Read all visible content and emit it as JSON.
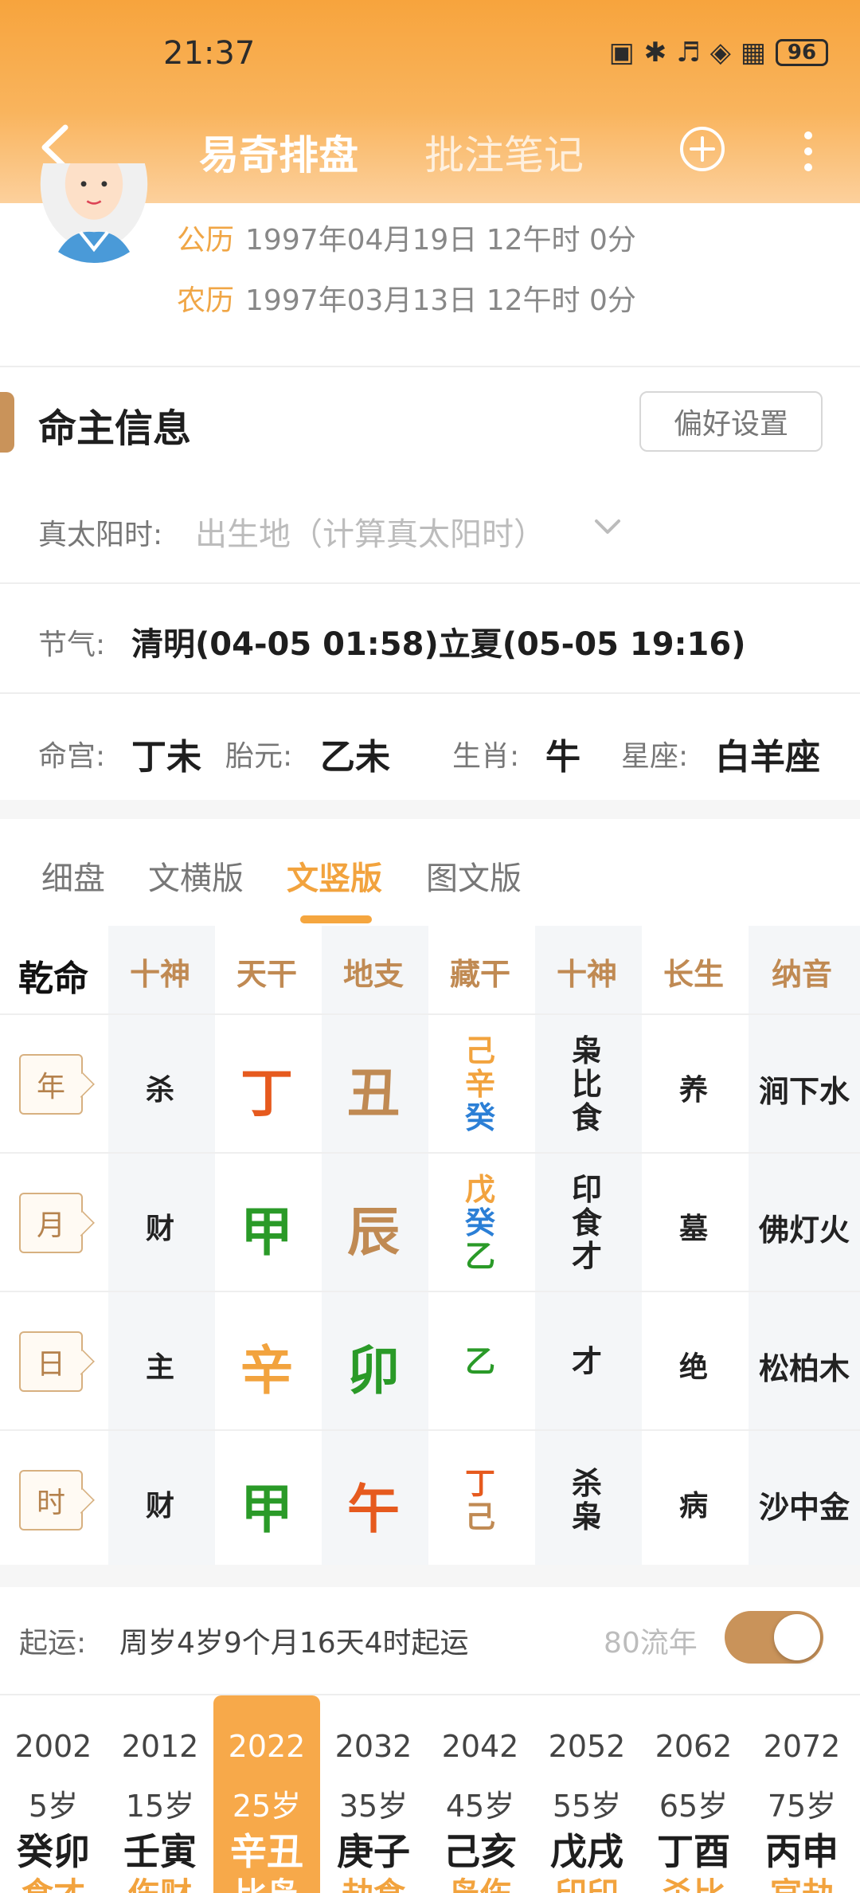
{
  "status": {
    "time": "21:37",
    "battery": "96"
  },
  "header": {
    "active_tab": "易奇排盘",
    "inactive_tab": "批注笔记"
  },
  "profile": {
    "solar_label": "公历",
    "solar_value": "1997年04月19日 12午时 0分",
    "lunar_label": "农历",
    "lunar_value": "1997年03月13日 12午时 0分"
  },
  "section": {
    "title": "命主信息",
    "pref_button": "偏好设置"
  },
  "solar_time": {
    "label": "真太阳时:",
    "placeholder": "出生地（计算真太阳时）"
  },
  "jieqi": {
    "label": "节气:",
    "value": "清明(04-05 01:58)立夏(05-05 19:16)"
  },
  "info": {
    "minggong_label": "命宫:",
    "minggong": "丁未",
    "taiyuan_label": "胎元:",
    "taiyuan": "乙未",
    "shengxiao_label": "生肖:",
    "shengxiao": "牛",
    "xingzuo_label": "星座:",
    "xingzuo": "白羊座"
  },
  "view_tabs": [
    "细盘",
    "文横版",
    "文竖版",
    "图文版"
  ],
  "grid": {
    "headers": [
      "乾命",
      "十神",
      "天干",
      "地支",
      "藏干",
      "十神",
      "长生",
      "纳音"
    ],
    "rows": [
      {
        "pillar": "年",
        "shishen": "杀",
        "tiangan": "丁",
        "dizhi": "丑",
        "canggan": [
          "己",
          "辛",
          "癸"
        ],
        "shishen2": [
          "枭",
          "比",
          "食"
        ],
        "changsheng": "养",
        "nayin": "涧下水"
      },
      {
        "pillar": "月",
        "shishen": "财",
        "tiangan": "甲",
        "dizhi": "辰",
        "canggan": [
          "戊",
          "癸",
          "乙"
        ],
        "shishen2": [
          "印",
          "食",
          "才"
        ],
        "changsheng": "墓",
        "nayin": "佛灯火"
      },
      {
        "pillar": "日",
        "shishen": "主",
        "tiangan": "辛",
        "dizhi": "卯",
        "canggan": [
          "乙"
        ],
        "shishen2": [
          "才"
        ],
        "changsheng": "绝",
        "nayin": "松柏木"
      },
      {
        "pillar": "时",
        "shishen": "财",
        "tiangan": "甲",
        "dizhi": "午",
        "canggan": [
          "丁",
          "己"
        ],
        "shishen2": [
          "杀",
          "枭"
        ],
        "changsheng": "病",
        "nayin": "沙中金"
      }
    ],
    "colors": {
      "tiangan": [
        "orange",
        "green",
        "gold",
        "green"
      ],
      "dizhi": [
        "brown",
        "brown",
        "green",
        "orange"
      ],
      "canggan": [
        [
          "gold",
          "gold",
          "blue"
        ],
        [
          "gold",
          "blue",
          "green"
        ],
        [
          "green"
        ],
        [
          "orange",
          "brown"
        ]
      ]
    }
  },
  "qiyun": {
    "label": "起运:",
    "value": "周岁4岁9个月16天4时起运",
    "liunian_label": "80流年",
    "toggle_on": true
  },
  "dayun": [
    {
      "year": "2002",
      "age": "5岁",
      "ganzhi": "癸卯",
      "peek": "食才"
    },
    {
      "year": "2012",
      "age": "15岁",
      "ganzhi": "壬寅",
      "peek": "伤财"
    },
    {
      "year": "2022",
      "age": "25岁",
      "ganzhi": "辛丑",
      "peek": "比枭",
      "active": true
    },
    {
      "year": "2032",
      "age": "35岁",
      "ganzhi": "庚子",
      "peek": "劫食"
    },
    {
      "year": "2042",
      "age": "45岁",
      "ganzhi": "己亥",
      "peek": "枭伤"
    },
    {
      "year": "2052",
      "age": "55岁",
      "ganzhi": "戊戌",
      "peek": "印印"
    },
    {
      "year": "2062",
      "age": "65岁",
      "ganzhi": "丁酉",
      "peek": "杀比"
    },
    {
      "year": "2072",
      "age": "75岁",
      "ganzhi": "丙申",
      "peek": "官劫"
    }
  ]
}
